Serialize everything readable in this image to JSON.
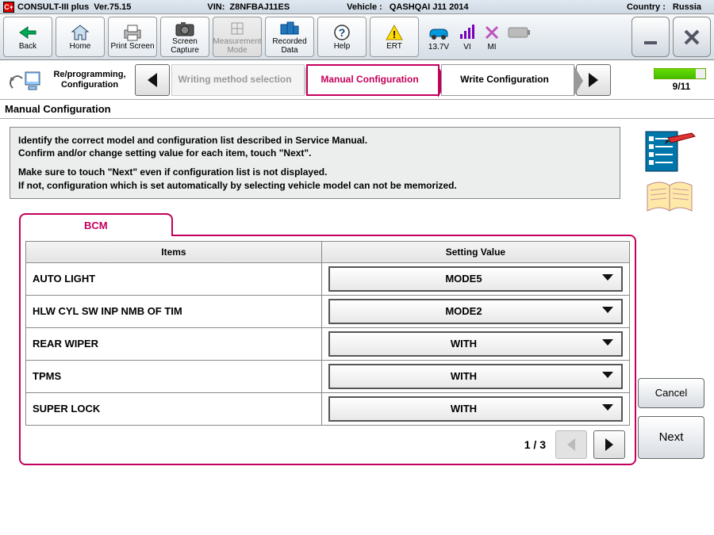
{
  "titlebar": {
    "app": "CONSULT-III plus",
    "version": "Ver.75.15",
    "vin_label": "VIN:",
    "vin": "Z8NFBAJ11ES",
    "vehicle_label": "Vehicle :",
    "vehicle": "QASHQAI J11 2014",
    "country_label": "Country :",
    "country": "Russia"
  },
  "toolbar": {
    "back": "Back",
    "home": "Home",
    "print": "Print Screen",
    "capture": "Screen Capture",
    "measurement": "Measurement Mode",
    "recorded": "Recorded Data",
    "help": "Help",
    "ert": "ERT"
  },
  "status": {
    "voltage": "13.7V",
    "vi": "VI",
    "mi": "MI"
  },
  "steps": {
    "root": "Re/programming, Configuration",
    "writing": "Writing method selection",
    "manual": "Manual Configuration",
    "write": "Write Configuration",
    "progress": "9/11",
    "progress_pct": 82
  },
  "section_title": "Manual Configuration",
  "instruction": {
    "l1": "Identify the correct model and configuration list described in Service Manual.",
    "l2": "Confirm and/or change setting value for each item, touch \"Next\".",
    "l3": "Make sure to touch \"Next\" even if configuration list is not displayed.",
    "l4": "If not, configuration which is set automatically by selecting vehicle model can not be memorized."
  },
  "tab": {
    "label": "BCM"
  },
  "table": {
    "col_items": "Items",
    "col_value": "Setting Value",
    "rows": [
      {
        "item": "AUTO LIGHT",
        "value": "MODE5"
      },
      {
        "item": "HLW CYL SW INP NMB OF TIM",
        "value": "MODE2"
      },
      {
        "item": "REAR WIPER",
        "value": "WITH"
      },
      {
        "item": "TPMS",
        "value": "WITH"
      },
      {
        "item": "SUPER LOCK",
        "value": "WITH"
      }
    ]
  },
  "pager": {
    "info": "1 / 3"
  },
  "actions": {
    "cancel": "Cancel",
    "next": "Next"
  }
}
